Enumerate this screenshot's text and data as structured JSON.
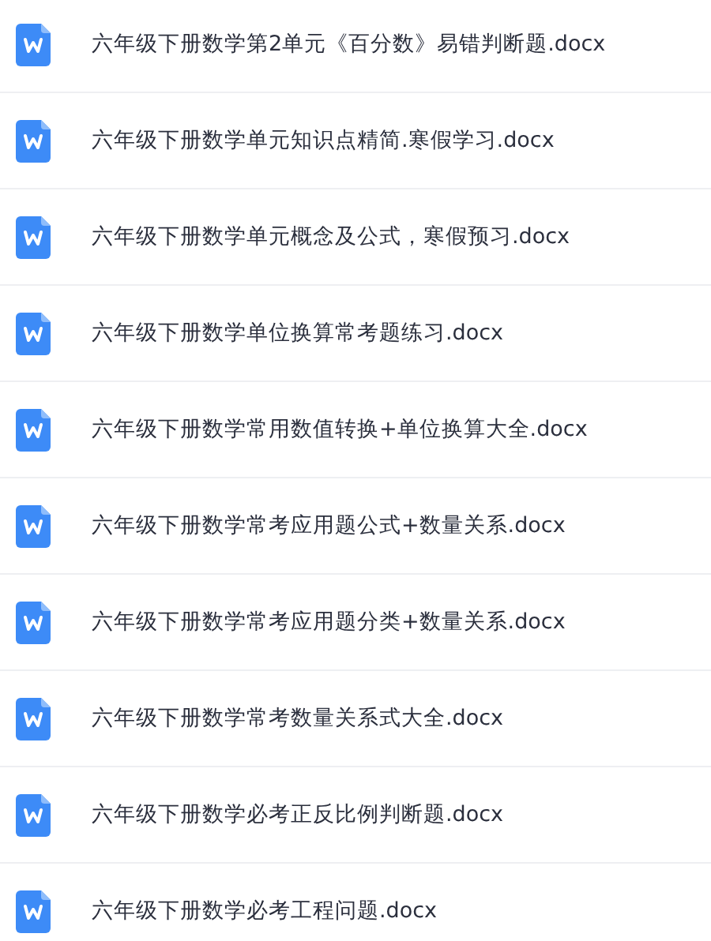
{
  "files": [
    {
      "name": "六年级下册数学第2单元《百分数》易错判断题.docx"
    },
    {
      "name": "六年级下册数学单元知识点精简.寒假学习.docx"
    },
    {
      "name": "六年级下册数学单元概念及公式，寒假预习.docx"
    },
    {
      "name": "六年级下册数学单位换算常考题练习.docx"
    },
    {
      "name": "六年级下册数学常用数值转换+单位换算大全.docx"
    },
    {
      "name": "六年级下册数学常考应用题公式+数量关系.docx"
    },
    {
      "name": "六年级下册数学常考应用题分类+数量关系.docx"
    },
    {
      "name": "六年级下册数学常考数量关系式大全.docx"
    },
    {
      "name": "六年级下册数学必考正反比例判断题.docx"
    },
    {
      "name": "六年级下册数学必考工程问题.docx"
    }
  ]
}
